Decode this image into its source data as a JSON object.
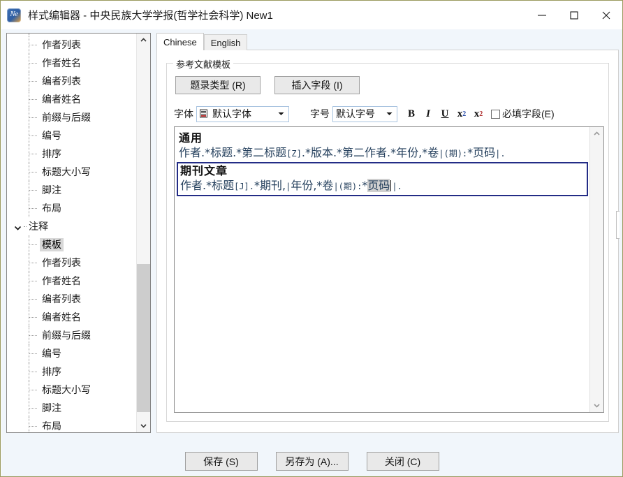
{
  "window": {
    "title": "样式编辑器 - 中央民族大学学报(哲学社会科学) New1",
    "app_icon": "noteexpress-icon",
    "icon_text": "Ne",
    "controls": {
      "minimize": "minimize-icon",
      "maximize": "maximize-icon",
      "close": "close-icon"
    }
  },
  "sidebar": {
    "name": "style-section-tree",
    "items": [
      {
        "label": "作者列表",
        "level": 1,
        "type": "leaf",
        "selected": false
      },
      {
        "label": "作者姓名",
        "level": 1,
        "type": "leaf",
        "selected": false
      },
      {
        "label": "编者列表",
        "level": 1,
        "type": "leaf",
        "selected": false
      },
      {
        "label": "编者姓名",
        "level": 1,
        "type": "leaf",
        "selected": false
      },
      {
        "label": "前缀与后缀",
        "level": 1,
        "type": "leaf",
        "selected": false
      },
      {
        "label": "编号",
        "level": 1,
        "type": "leaf",
        "selected": false
      },
      {
        "label": "排序",
        "level": 1,
        "type": "leaf",
        "selected": false
      },
      {
        "label": "标题大小写",
        "level": 1,
        "type": "leaf",
        "selected": false
      },
      {
        "label": "脚注",
        "level": 1,
        "type": "leaf",
        "selected": false
      },
      {
        "label": "布局",
        "level": 1,
        "type": "leaf",
        "selected": false
      },
      {
        "label": "注释",
        "level": 0,
        "type": "group",
        "expanded": true,
        "selected": false
      },
      {
        "label": "模板",
        "level": 1,
        "type": "leaf",
        "selected": true
      },
      {
        "label": "作者列表",
        "level": 1,
        "type": "leaf",
        "selected": false
      },
      {
        "label": "作者姓名",
        "level": 1,
        "type": "leaf",
        "selected": false
      },
      {
        "label": "编者列表",
        "level": 1,
        "type": "leaf",
        "selected": false
      },
      {
        "label": "编者姓名",
        "level": 1,
        "type": "leaf",
        "selected": false
      },
      {
        "label": "前缀与后缀",
        "level": 1,
        "type": "leaf",
        "selected": false
      },
      {
        "label": "编号",
        "level": 1,
        "type": "leaf",
        "selected": false
      },
      {
        "label": "排序",
        "level": 1,
        "type": "leaf",
        "selected": false
      },
      {
        "label": "标题大小写",
        "level": 1,
        "type": "leaf",
        "selected": false
      },
      {
        "label": "脚注",
        "level": 1,
        "type": "leaf",
        "selected": false
      },
      {
        "label": "布局",
        "level": 1,
        "type": "leaf",
        "selected": false
      }
    ]
  },
  "tabs": [
    {
      "label": "Chinese",
      "active": true
    },
    {
      "label": "English",
      "active": false
    }
  ],
  "groupbox": {
    "title": "参考文献模板"
  },
  "toolbar": {
    "record_type_label": "题录类型 (R)",
    "record_type_accel": "R",
    "insert_field_label": "插入字段 (I)",
    "insert_field_accel": "I",
    "font_label": "字体",
    "font_value": "默认字体",
    "font_icon": "font-icon",
    "size_label": "字号",
    "size_value": "默认字号",
    "bold_label": "B",
    "italic_label": "I",
    "underline_label": "U",
    "subscript_label": "x",
    "subscript_index": "2",
    "superscript_label": "x",
    "superscript_index": "2",
    "required_field_label": "必填字段(E)",
    "required_field_checked": false
  },
  "editor": {
    "name": "template-editor",
    "blocks": [
      {
        "heading": "通用",
        "selected": false,
        "segments": [
          {
            "text": "作者.*标题.*第二标题",
            "style": "normal"
          },
          {
            "text": "[Z]",
            "style": "small"
          },
          {
            "text": ".*版本.*第二作者.*年份,*卷",
            "style": "normal"
          },
          {
            "text": "|",
            "style": "small"
          },
          {
            "text": "(期)",
            "style": "small"
          },
          {
            "text": ":",
            "style": "small"
          },
          {
            "text": "*页码",
            "style": "normal"
          },
          {
            "text": "|.",
            "style": "small"
          }
        ]
      },
      {
        "heading": "期刊文章",
        "selected": true,
        "segments": [
          {
            "text": "作者.*标题",
            "style": "normal"
          },
          {
            "text": "[J]",
            "style": "small"
          },
          {
            "text": ".",
            "style": "small"
          },
          {
            "text": "*期刊,",
            "style": "normal"
          },
          {
            "text": "|",
            "style": "small"
          },
          {
            "text": "年份,*卷",
            "style": "normal"
          },
          {
            "text": "|",
            "style": "small"
          },
          {
            "text": "(期)",
            "style": "small"
          },
          {
            "text": ":",
            "style": "small"
          },
          {
            "text": "*",
            "style": "normal"
          },
          {
            "text": "页码",
            "style": "highlight"
          },
          {
            "text": "|.",
            "style": "small"
          }
        ]
      }
    ]
  },
  "footer": {
    "save_label": "保存 (S)",
    "save_accel": "S",
    "save_as_label": "另存为 (A)...",
    "save_as_accel": "A",
    "close_label": "关闭 (C)",
    "close_accel": "C"
  },
  "colors": {
    "selection_border": "#232c86",
    "editor_text": "#26415e",
    "client_bg": "#f1f6fb",
    "selection_highlight": "#cfcfcf"
  }
}
